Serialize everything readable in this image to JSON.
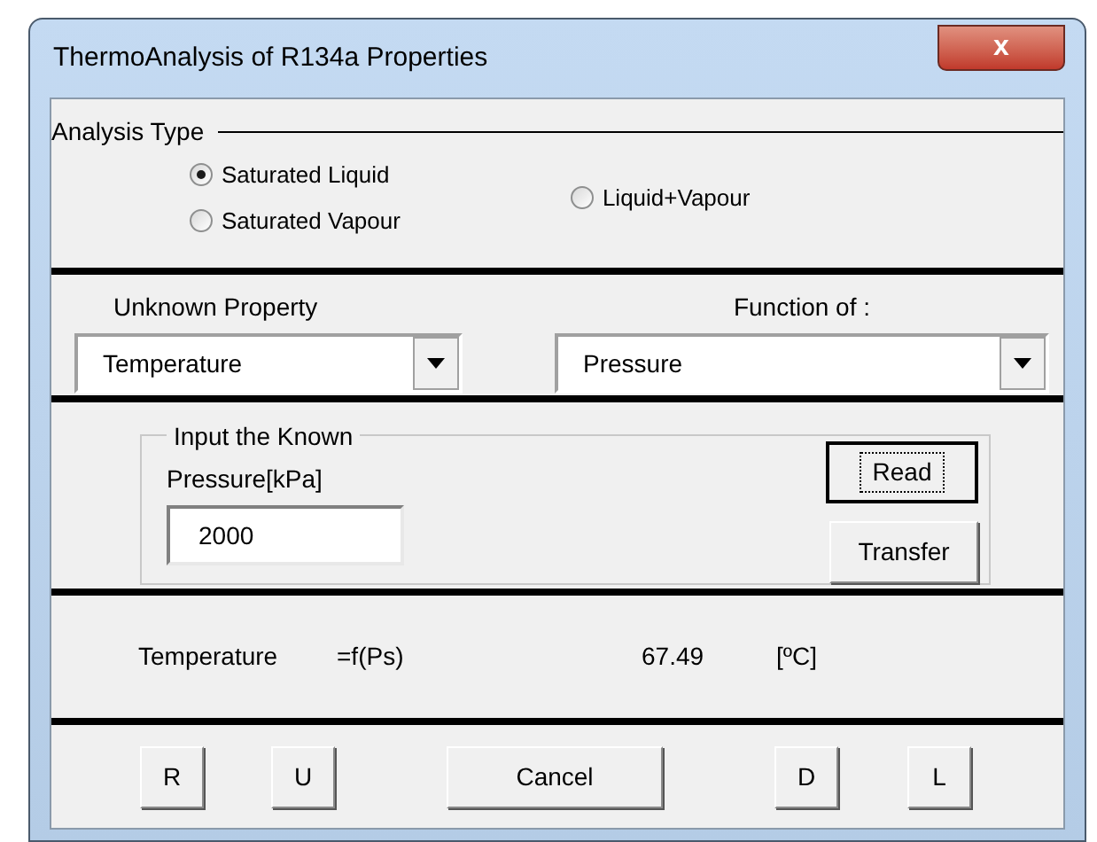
{
  "window": {
    "title": "ThermoAnalysis of R134a Properties",
    "close": "x"
  },
  "analysis_type": {
    "label": "Analysis Type",
    "options": [
      {
        "label": "Saturated Liquid",
        "selected": true
      },
      {
        "label": "Saturated Vapour",
        "selected": false
      },
      {
        "label": "Liquid+Vapour",
        "selected": false
      }
    ]
  },
  "unknown_property": {
    "label": "Unknown Property",
    "value": "Temperature"
  },
  "function_of": {
    "label": "Function of :",
    "value": "Pressure"
  },
  "input": {
    "group_label": "Input the Known",
    "label": "Pressure[kPa]",
    "value": "2000"
  },
  "side_buttons": [
    {
      "label": "Read",
      "focused": true
    },
    {
      "label": "Transfer",
      "focused": false
    }
  ],
  "result": {
    "property": "Temperature",
    "function": "=f(Ps)",
    "value": "67.49",
    "unit": "[ºC]"
  },
  "buttons": [
    "R",
    "U",
    "Cancel",
    "D",
    "L"
  ]
}
